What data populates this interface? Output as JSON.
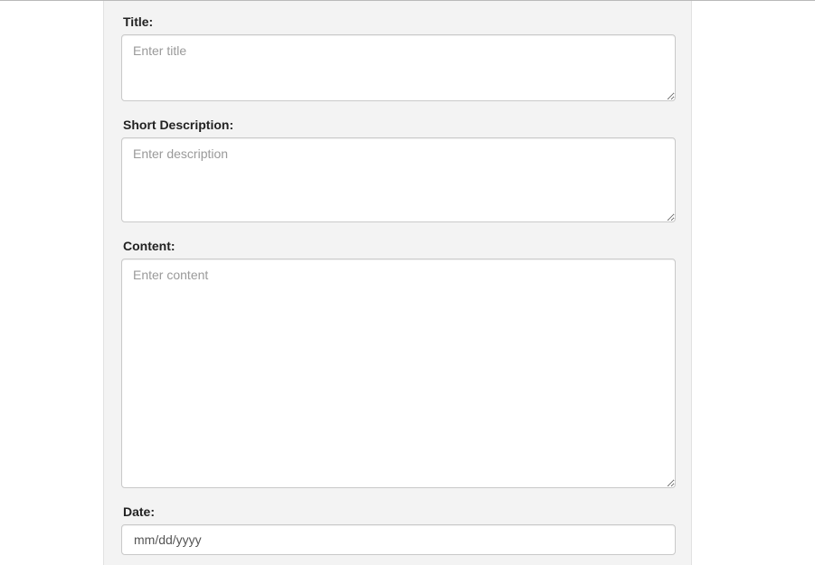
{
  "form": {
    "title": {
      "label": "Title:",
      "placeholder": "Enter title",
      "value": ""
    },
    "short_description": {
      "label": "Short Description:",
      "placeholder": "Enter description",
      "value": ""
    },
    "content": {
      "label": "Content:",
      "placeholder": "Enter content",
      "value": ""
    },
    "date": {
      "label": "Date:",
      "display": "mm/dd/yyyy"
    }
  },
  "colors": {
    "page_background": "#ffffff",
    "panel_background": "#f3f3f3",
    "field_border": "#c9c9c9",
    "label_text": "#222222",
    "placeholder_text": "#9a9a9a"
  }
}
